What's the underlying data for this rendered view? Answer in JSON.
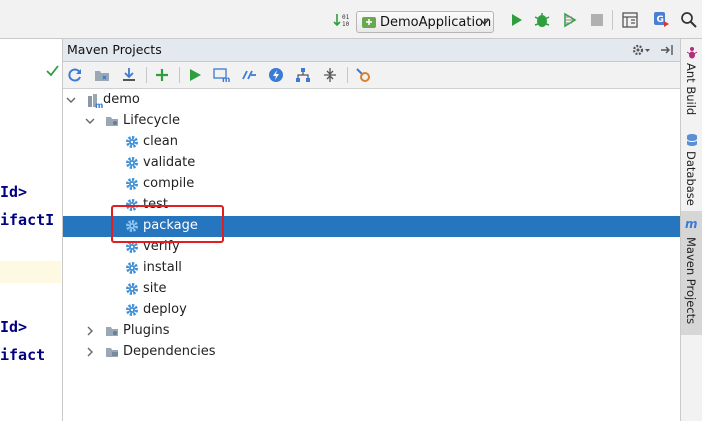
{
  "toolbar": {
    "run_configuration": "DemoApplication",
    "icons": [
      "sort-icon",
      "run-config-icon",
      "run-icon",
      "debug-icon",
      "coverage-icon",
      "stop-icon",
      "project-structure-icon",
      "translate-icon",
      "search-icon"
    ],
    "colors": {
      "run": "#2e9e3f",
      "stop": "#b0b0b0"
    }
  },
  "editor": {
    "code_lines": [
      "Id>",
      "ifactI",
      "Id>",
      "ifact"
    ]
  },
  "maven_panel": {
    "title": "Maven Projects",
    "toolbar_icons": [
      "refresh-icon",
      "generate-sources-icon",
      "download-icon",
      "add-icon",
      "run-maven-build-icon",
      "execute-goal-icon",
      "toggle-offline-icon",
      "skip-tests-icon",
      "show-dependencies-icon",
      "collapse-all-icon",
      "settings-icon"
    ],
    "tree": {
      "root": "demo",
      "lifecycle_label": "Lifecycle",
      "lifecycle_goals": [
        "clean",
        "validate",
        "compile",
        "test",
        "package",
        "verify",
        "install",
        "site",
        "deploy"
      ],
      "selected_goal": "package",
      "plugins_label": "Plugins",
      "dependencies_label": "Dependencies"
    },
    "selection_color": "#2675bf"
  },
  "right_strip": {
    "tabs": [
      "Ant Build",
      "Database",
      "Maven Projects"
    ],
    "active_tab": "Maven Projects"
  }
}
